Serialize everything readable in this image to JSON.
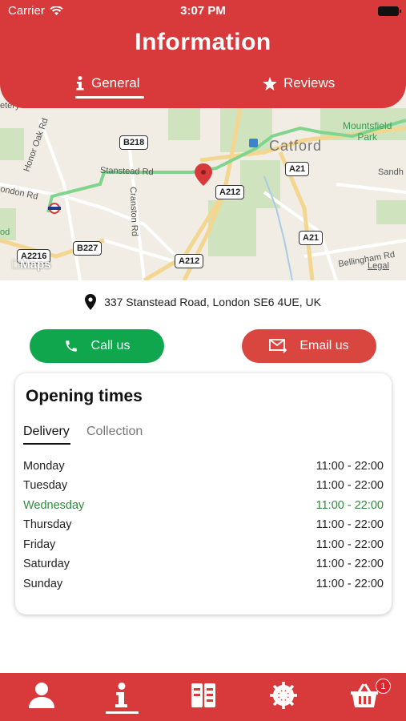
{
  "status_bar": {
    "carrier": "Carrier",
    "time": "3:07 PM"
  },
  "header": {
    "title": "Information",
    "tabs": [
      {
        "label": "General",
        "icon": "info-icon",
        "active": true
      },
      {
        "label": "Reviews",
        "icon": "star-icon",
        "active": false
      }
    ]
  },
  "map": {
    "brand": "Maps",
    "legal": "Legal",
    "labels": {
      "catford": "Catford",
      "mountsfield_1": "Mountsfield",
      "mountsfield_2": "Park",
      "stanstead": "Stanstead Rd",
      "cranston": "Cranston Rd",
      "honor_oak": "Honor Oak Rd",
      "london_rd": "ondon Rd",
      "bellingham": "Bellingham Rd",
      "sandhu": "Sandh",
      "od": "od",
      "etery": "etery"
    },
    "roads": {
      "b218": "B218",
      "a21_top": "A21",
      "a212_mid": "A212",
      "a21_bot": "A21",
      "b227": "B227",
      "a212_bot": "A212",
      "a2216": "A2216"
    }
  },
  "address": {
    "icon": "location-pin-icon",
    "text": "337 Stanstead Road, London SE6 4UE, UK"
  },
  "actions": {
    "call_label": "Call us",
    "email_label": "Email us",
    "call_color": "#0fa64e",
    "email_color": "#d8463f"
  },
  "opening": {
    "title": "Opening times",
    "tabs": [
      "Delivery",
      "Collection"
    ],
    "days": [
      {
        "day": "Monday",
        "hours": "11:00 - 22:00"
      },
      {
        "day": "Tuesday",
        "hours": "11:00 - 22:00"
      },
      {
        "day": "Wednesday",
        "hours": "11:00 - 22:00",
        "today": true
      },
      {
        "day": "Thursday",
        "hours": "11:00 - 22:00"
      },
      {
        "day": "Friday",
        "hours": "11:00 - 22:00"
      },
      {
        "day": "Saturday",
        "hours": "11:00 - 22:00"
      },
      {
        "day": "Sunday",
        "hours": "11:00 - 22:00"
      }
    ]
  },
  "bottom_nav": {
    "items": [
      "profile-icon",
      "info-icon",
      "menu-icon",
      "settings-icon",
      "basket-icon"
    ],
    "basket_badge": "1"
  },
  "colors": {
    "brand_red": "#d8393b",
    "today_green": "#2d8a3c"
  }
}
